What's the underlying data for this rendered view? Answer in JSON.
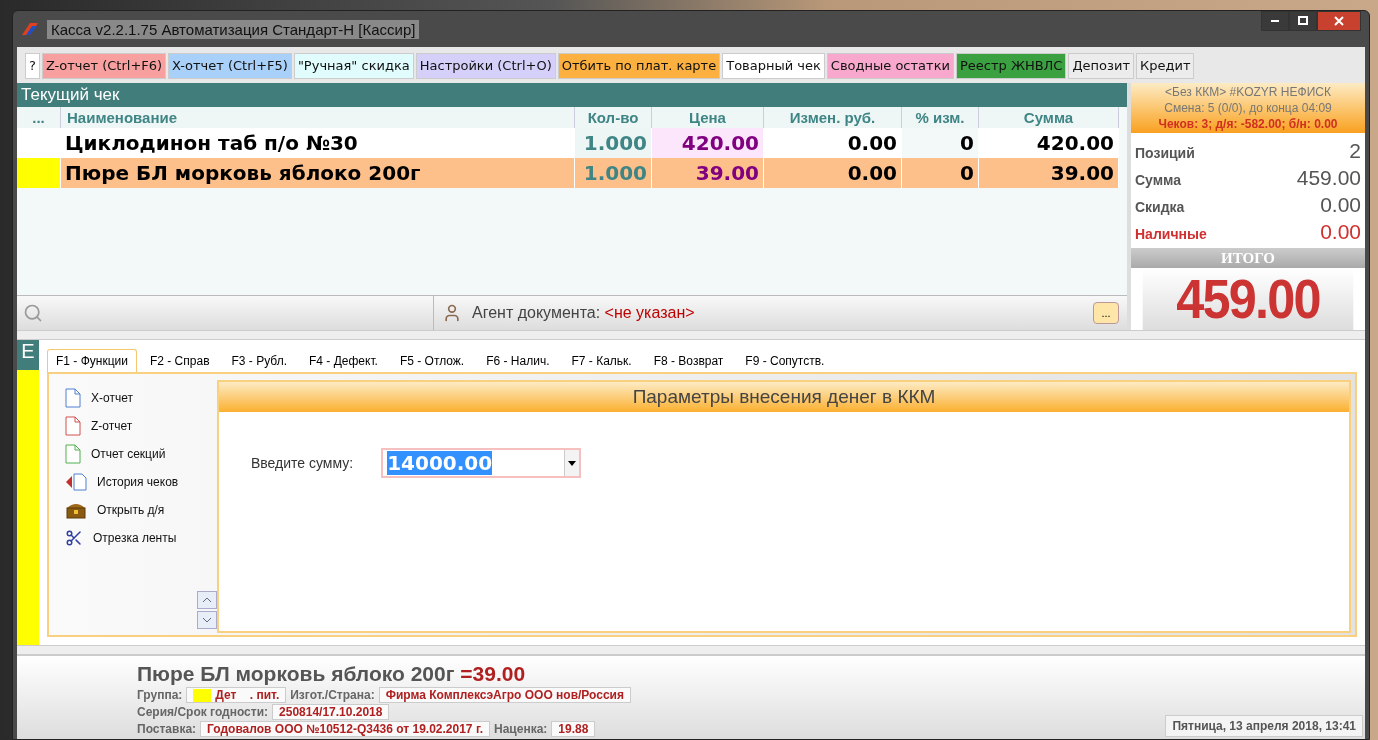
{
  "window": {
    "title": "Касса v2.2.1.75 Автоматизация Стандарт-Н [Кассир]"
  },
  "toolbar": [
    {
      "label": "?",
      "color": "#ffffff"
    },
    {
      "label": "Z-отчет (Ctrl+F6)",
      "color": "#f8a0a0"
    },
    {
      "label": "X-отчет (Ctrl+F5)",
      "color": "#a8d0f8"
    },
    {
      "label": "\"Ручная\" скидка",
      "color": "#e0fcfc"
    },
    {
      "label": "Настройки (Ctrl+O)",
      "color": "#d4d0fa"
    },
    {
      "label": "Отбить по плат. карте",
      "color": "#fbb040"
    },
    {
      "label": "Товарный чек",
      "color": "#ffffff"
    },
    {
      "label": "Сводные остатки",
      "color": "#f8a8cc"
    },
    {
      "label": "Реестр ЖНВЛС",
      "color": "#3aa040"
    },
    {
      "label": "Депозит",
      "color": "#ececec"
    },
    {
      "label": "Кредит",
      "color": "#ececec"
    }
  ],
  "receipt": {
    "title": "Текущий чек",
    "columns": [
      "...",
      "Наименование",
      "Кол-во",
      "Цена",
      "Измен. руб.",
      "% изм.",
      "Сумма"
    ],
    "rows": [
      {
        "name": "Циклодинон таб п/о №30",
        "qty": "1.000",
        "price": "420.00",
        "change": "0.00",
        "percent": "0",
        "sum": "420.00",
        "selected": false
      },
      {
        "name": "Пюре БЛ морковь яблоко 200г",
        "qty": "1.000",
        "price": "39.00",
        "change": "0.00",
        "percent": "0",
        "sum": "39.00",
        "selected": true
      }
    ],
    "agent_label": "Агент документа:",
    "agent_value": "<не указан>",
    "agent_button": "..."
  },
  "summary": {
    "header": [
      "<Без ККМ> #KOZYR НЕФИСК",
      "Смена: 5 (0/0), до конца 04:09",
      "Чеков: 3; д/я: -582.00; б/н: 0.00"
    ],
    "stats": [
      {
        "label": "Позиций",
        "value": "2",
        "kind": "plain"
      },
      {
        "label": "Сумма",
        "value": "459.00",
        "kind": "plain"
      },
      {
        "label": "Скидка",
        "value": "0.00",
        "kind": "plain"
      },
      {
        "label": "Наличные",
        "value": "0.00",
        "kind": "payment"
      }
    ],
    "total_label": "ИТОГО",
    "total": "459.00"
  },
  "side_strip": {
    "label": "Е"
  },
  "tabs": [
    {
      "label": "F1 - Функции",
      "selected": true
    },
    {
      "label": "F2 - Справ",
      "selected": false
    },
    {
      "label": "F3 - Рубл.",
      "selected": false
    },
    {
      "label": "F4 - Дефект.",
      "selected": false
    },
    {
      "label": "F5 - Отлож.",
      "selected": false
    },
    {
      "label": "F6 - Налич.",
      "selected": false
    },
    {
      "label": "F7 - Кальк.",
      "selected": false
    },
    {
      "label": "F8 - Возврат",
      "selected": false
    },
    {
      "label": "F9 - Сопутств.",
      "selected": false
    }
  ],
  "functions": [
    "X-отчет",
    "Z-отчет",
    "Отчет секций",
    "История чеков",
    "Открыть д/я",
    "Отрезка ленты"
  ],
  "panel": {
    "title": "Параметры внесения денег в ККМ",
    "field_label": "Введите сумму:",
    "field_value": "14000.00"
  },
  "product": {
    "name": "Пюре БЛ морковь яблоко 200г",
    "price": "=39.00",
    "lines": [
      [
        {
          "label": "Группа:",
          "value": "Дет    . пит.",
          "color": "#ffff00"
        },
        {
          "label": "Изгот./Страна:",
          "value": "Фирма КомплексэАгро ООО нов/Россия"
        }
      ],
      [
        {
          "label": "Серия/Срок годности:",
          "value": "250814/17.10.2018"
        }
      ],
      [
        {
          "label": "Поставка:",
          "value": "Годовалов ООО №10512-Q3436 от 19.02.2017 г."
        },
        {
          "label": "Наценка:",
          "value": "19.88"
        }
      ]
    ]
  },
  "status_bar": {
    "datetime": "Пятница, 13 апреля 2018, 13:41"
  }
}
